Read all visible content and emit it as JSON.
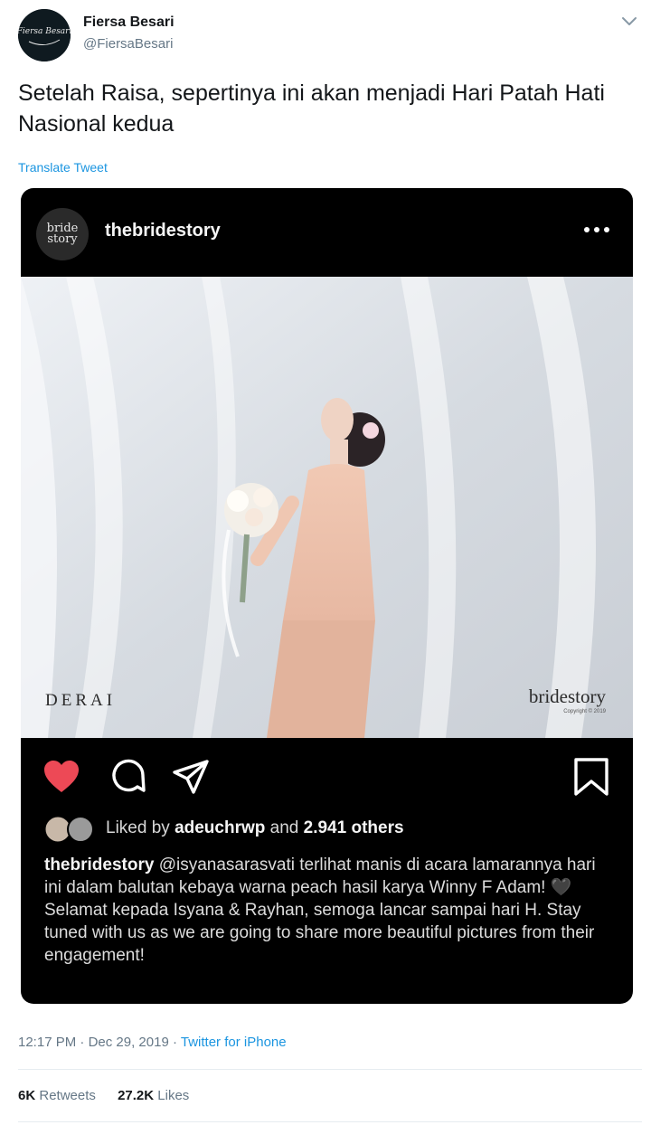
{
  "tweet": {
    "display_name": "Fiersa Besari",
    "handle": "@FiersaBesari",
    "avatar_text": "Fiersa Besari",
    "text": "Setelah Raisa, sepertinya ini akan menjadi Hari Patah Hati Nasional kedua",
    "translate_label": "Translate Tweet",
    "time": "12:17 PM",
    "date": "Dec 29, 2019",
    "separator": "·",
    "source": "Twitter for iPhone",
    "retweets_count": "6K",
    "retweets_label": "Retweets",
    "likes_count": "27.2K",
    "likes_label": "Likes"
  },
  "embed": {
    "username": "thebridestory",
    "avatar_text": "bride story",
    "photo_watermark_left": "DERAI",
    "photo_watermark_right": "bridestory",
    "photo_copyright": "Copyright © 2019",
    "liked_prefix": "Liked by",
    "liked_user": "adeuchrwp",
    "liked_and": "and",
    "liked_others": "2.941 others",
    "caption_user": "thebridestory",
    "caption_text": "@isyanasarasvati terlihat manis di acara lamarannya hari ini dalam balutan kebaya warna peach hasil karya Winny F Adam! 🖤 Selamat kepada Isyana & Rayhan, semoga lancar sampai hari H. Stay tuned with us as we are going to share more beautiful pictures from their engagement!"
  },
  "colors": {
    "link": "#1b95e0",
    "heart": "#ed4956",
    "embed_bg": "#000000",
    "secondary_text": "#657786"
  },
  "icons": [
    "chevron-down-icon",
    "more-dots-icon",
    "heart-icon",
    "comment-icon",
    "share-icon",
    "bookmark-icon"
  ]
}
